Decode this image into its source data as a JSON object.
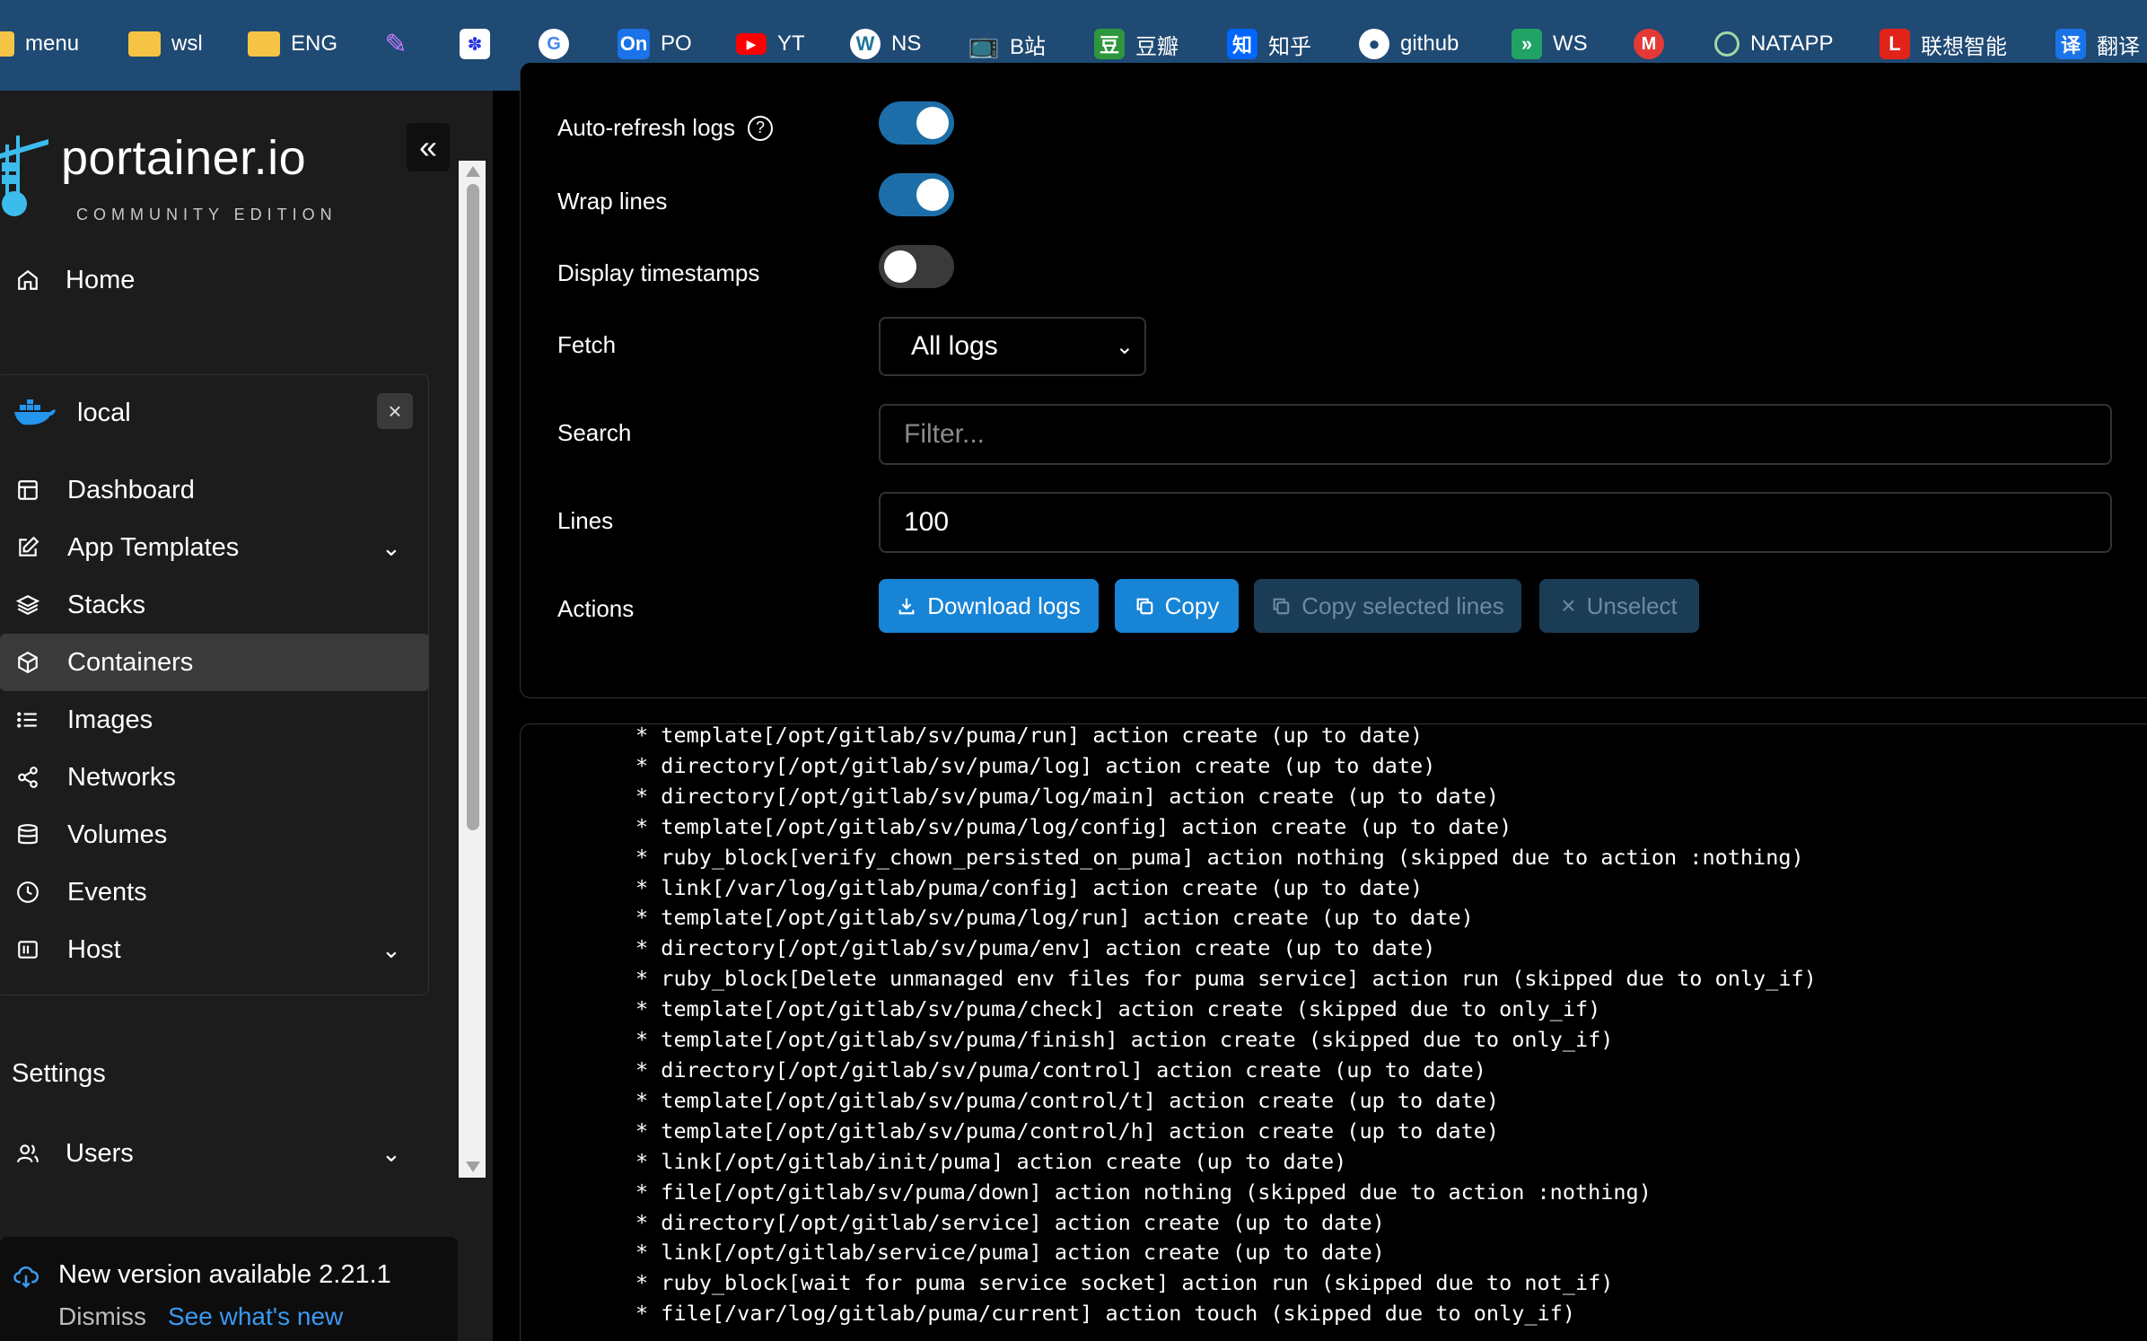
{
  "bookmarks": [
    {
      "label": "menu",
      "icon": "folder-icon"
    },
    {
      "label": "wsl",
      "icon": "folder-icon"
    },
    {
      "label": "ENG",
      "icon": "folder-icon"
    },
    {
      "label": "",
      "icon": "pattern-icon"
    },
    {
      "label": "",
      "icon": "baidu-icon"
    },
    {
      "label": "",
      "icon": "google-icon"
    },
    {
      "label": "PO",
      "icon": "on-icon"
    },
    {
      "label": "YT",
      "icon": "youtube-icon"
    },
    {
      "label": "NS",
      "icon": "wordpress-icon"
    },
    {
      "label": "B站",
      "icon": "bilibili-icon"
    },
    {
      "label": "豆瓣",
      "icon": "douban-icon"
    },
    {
      "label": "知乎",
      "icon": "zhihu-icon"
    },
    {
      "label": "github",
      "icon": "github-icon"
    },
    {
      "label": "WS",
      "icon": "ws-icon"
    },
    {
      "label": "",
      "icon": "m-icon"
    },
    {
      "label": "NATAPP",
      "icon": "natapp-icon"
    },
    {
      "label": "联想智能",
      "icon": "lenovo-icon"
    },
    {
      "label": "翻译",
      "icon": "translate-icon"
    }
  ],
  "sidebar": {
    "logo_text": "portainer.io",
    "logo_sub": "COMMUNITY EDITION",
    "home": "Home",
    "env_name": "local",
    "items": [
      {
        "label": "Dashboard"
      },
      {
        "label": "App Templates"
      },
      {
        "label": "Stacks"
      },
      {
        "label": "Containers"
      },
      {
        "label": "Images"
      },
      {
        "label": "Networks"
      },
      {
        "label": "Volumes"
      },
      {
        "label": "Events"
      },
      {
        "label": "Host"
      }
    ],
    "settings_title": "Settings",
    "users": "Users",
    "update_title": "New version available 2.21.1",
    "update_dismiss": "Dismiss",
    "update_link": "See what's new"
  },
  "settings": {
    "auto_refresh_label": "Auto-refresh logs",
    "auto_refresh_on": true,
    "wrap_lines_label": "Wrap lines",
    "wrap_lines_on": true,
    "timestamps_label": "Display timestamps",
    "timestamps_on": false,
    "fetch_label": "Fetch",
    "fetch_value": "All logs",
    "search_label": "Search",
    "search_placeholder": "Filter...",
    "lines_label": "Lines",
    "lines_value": "100",
    "actions_label": "Actions",
    "download": "Download logs",
    "copy": "Copy",
    "copy_selected": "Copy selected lines",
    "unselect": "Unselect"
  },
  "logs": [
    "* template[/opt/gitlab/sv/puma/run] action create (up to date)",
    "* directory[/opt/gitlab/sv/puma/log] action create (up to date)",
    "* directory[/opt/gitlab/sv/puma/log/main] action create (up to date)",
    "* template[/opt/gitlab/sv/puma/log/config] action create (up to date)",
    "* ruby_block[verify_chown_persisted_on_puma] action nothing (skipped due to action :nothing)",
    "* link[/var/log/gitlab/puma/config] action create (up to date)",
    "* template[/opt/gitlab/sv/puma/log/run] action create (up to date)",
    "* directory[/opt/gitlab/sv/puma/env] action create (up to date)",
    "* ruby_block[Delete unmanaged env files for puma service] action run (skipped due to only_if)",
    "* template[/opt/gitlab/sv/puma/check] action create (skipped due to only_if)",
    "* template[/opt/gitlab/sv/puma/finish] action create (skipped due to only_if)",
    "* directory[/opt/gitlab/sv/puma/control] action create (up to date)",
    "* template[/opt/gitlab/sv/puma/control/t] action create (up to date)",
    "* template[/opt/gitlab/sv/puma/control/h] action create (up to date)",
    "* link[/opt/gitlab/init/puma] action create (up to date)",
    "* file[/opt/gitlab/sv/puma/down] action nothing (skipped due to action :nothing)",
    "* directory[/opt/gitlab/service] action create (up to date)",
    "* link[/opt/gitlab/service/puma] action create (up to date)",
    "* ruby_block[wait for puma service socket] action run (skipped due to not_if)",
    "* file[/var/log/gitlab/puma/current] action touch (skipped due to only_if)"
  ],
  "colors": {
    "bookmarks_bg": "#1f4a73",
    "sidebar_bg": "#1c1c1c",
    "accent": "#1784d6",
    "toggle_on": "#1d6ea8"
  }
}
